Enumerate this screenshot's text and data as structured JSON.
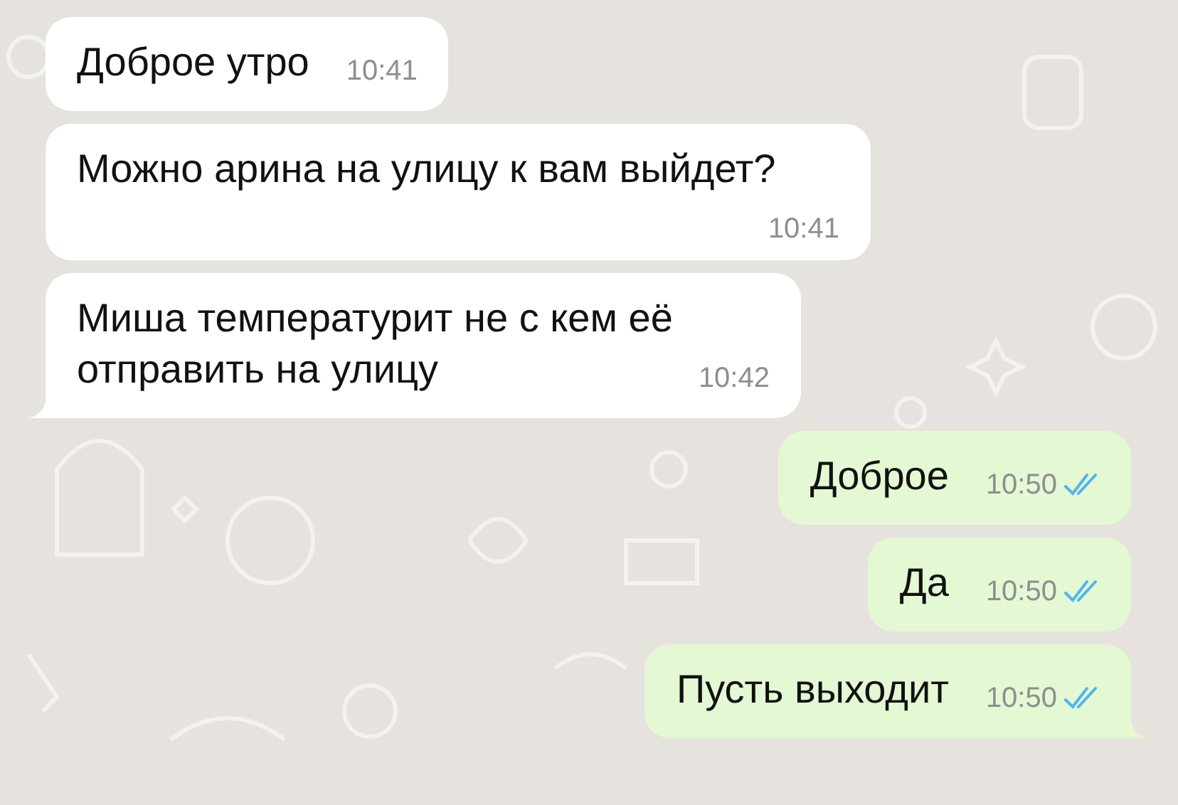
{
  "messages": [
    {
      "kind": "incoming",
      "text": "Доброе утро",
      "time": "10:41",
      "tail": false
    },
    {
      "kind": "incoming",
      "text": "Можно арина на улицу к вам выйдет?",
      "time": "10:41",
      "tail": false
    },
    {
      "kind": "incoming",
      "text": "Миша температурит не с кем её отправить на улицу",
      "time": "10:42",
      "tail": true
    },
    {
      "kind": "outgoing",
      "text": "Доброе",
      "time": "10:50",
      "read": true,
      "tail": false
    },
    {
      "kind": "outgoing",
      "text": "Да",
      "time": "10:50",
      "read": true,
      "tail": false
    },
    {
      "kind": "outgoing",
      "text": "Пусть выходит",
      "time": "10:50",
      "read": true,
      "tail": true
    }
  ]
}
